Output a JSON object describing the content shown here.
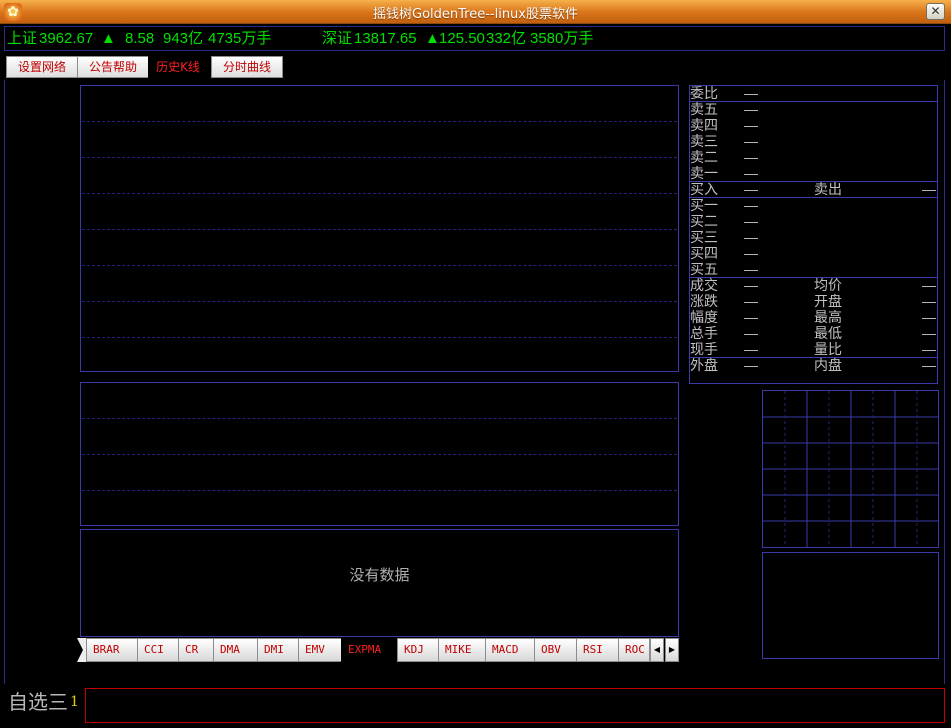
{
  "window": {
    "title": "摇钱树GoldenTree--linux股票软件",
    "close_glyph": "✕",
    "icon": "money-tree-app-icon"
  },
  "ticker": {
    "sh_name": "上证",
    "sh_index": "3962.67",
    "sh_arrow": "▲",
    "sh_change": "8.58",
    "sh_amount": "943亿",
    "sh_volume": "4735万手",
    "sz_name": "深证",
    "sz_index": "13817.65",
    "sz_arrow": "▲",
    "sz_change": "125.50",
    "sz_amount": "332亿",
    "sz_volume": "3580万手",
    "color": "#00e000"
  },
  "menu": {
    "items": [
      {
        "label": "设置网络"
      },
      {
        "label": "公告帮助"
      },
      {
        "label": "历史K线"
      },
      {
        "label": "分时曲线"
      }
    ]
  },
  "panels": {
    "no_data": "没有数据"
  },
  "indicators": {
    "tabs": [
      {
        "label": "BRAR"
      },
      {
        "label": "CCI"
      },
      {
        "label": "CR"
      },
      {
        "label": "DMA"
      },
      {
        "label": "DMI"
      },
      {
        "label": "EMV"
      },
      {
        "label": "EXPMA"
      },
      {
        "label": "KDJ"
      },
      {
        "label": "MIKE"
      },
      {
        "label": "MACD"
      },
      {
        "label": "OBV"
      },
      {
        "label": "RSI"
      },
      {
        "label": "ROC"
      }
    ],
    "scroll_left": "◀",
    "scroll_right": "▶"
  },
  "quote": {
    "weibi": {
      "label": "委比",
      "value": "—"
    },
    "sells": [
      {
        "label": "卖五",
        "value": "—"
      },
      {
        "label": "卖四",
        "value": "—"
      },
      {
        "label": "卖三",
        "value": "—"
      },
      {
        "label": "卖二",
        "value": "—"
      },
      {
        "label": "卖一",
        "value": "—"
      }
    ],
    "buyin": {
      "label": "买入",
      "value": "—",
      "label2": "卖出",
      "value2": "—"
    },
    "buys": [
      {
        "label": "买一",
        "value": "—"
      },
      {
        "label": "买二",
        "value": "—"
      },
      {
        "label": "买三",
        "value": "—"
      },
      {
        "label": "买四",
        "value": "—"
      },
      {
        "label": "买五",
        "value": "—"
      }
    ],
    "stats": [
      {
        "label": "成交",
        "value": "—",
        "label2": "均价",
        "value2": "—"
      },
      {
        "label": "涨跌",
        "value": "—",
        "label2": "开盘",
        "value2": "—"
      },
      {
        "label": "幅度",
        "value": "—",
        "label2": "最高",
        "value2": "—"
      },
      {
        "label": "总手",
        "value": "—",
        "label2": "最低",
        "value2": "—"
      },
      {
        "label": "现手",
        "value": "—",
        "label2": "量比",
        "value2": "—"
      }
    ],
    "outer": {
      "label": "外盘",
      "value": "—",
      "label2": "内盘",
      "value2": "—"
    }
  },
  "bottom": {
    "fav_label": "自选三",
    "fav_number": "1",
    "input_value": ""
  }
}
